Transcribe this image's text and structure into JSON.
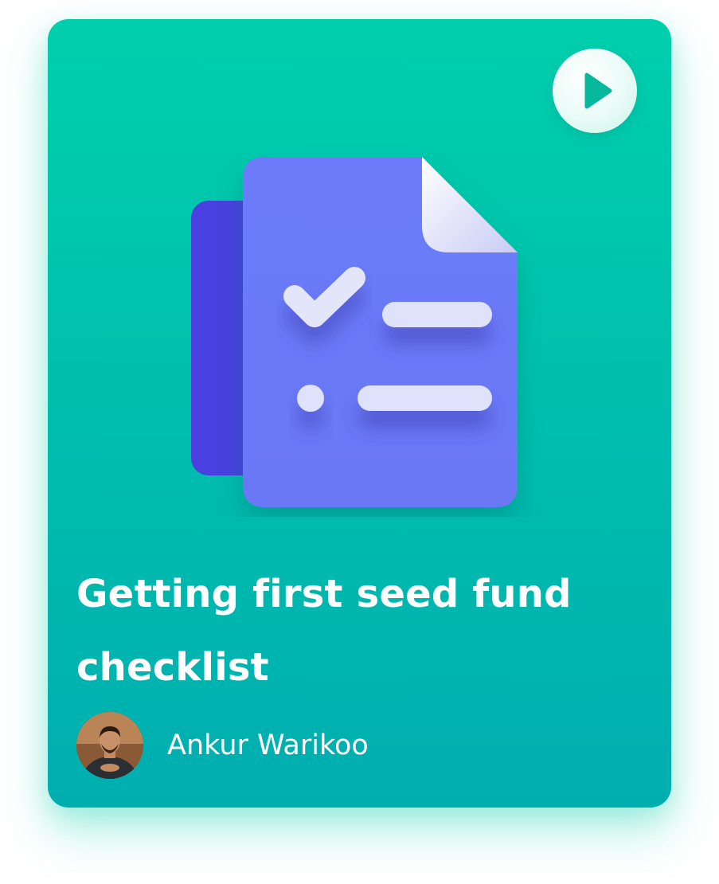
{
  "card": {
    "title": "Getting first seed fund checklist",
    "author": {
      "name": "Ankur Warikoo"
    }
  },
  "icons": {
    "play": "play-icon",
    "document": "checklist-document-icon"
  },
  "colors": {
    "card_gradient_top": "#00cfad",
    "card_gradient_bottom": "#00aeb0",
    "document_front": "#6b7cf9",
    "document_back": "#4a3fe0",
    "play_triangle": "#07b89d"
  }
}
